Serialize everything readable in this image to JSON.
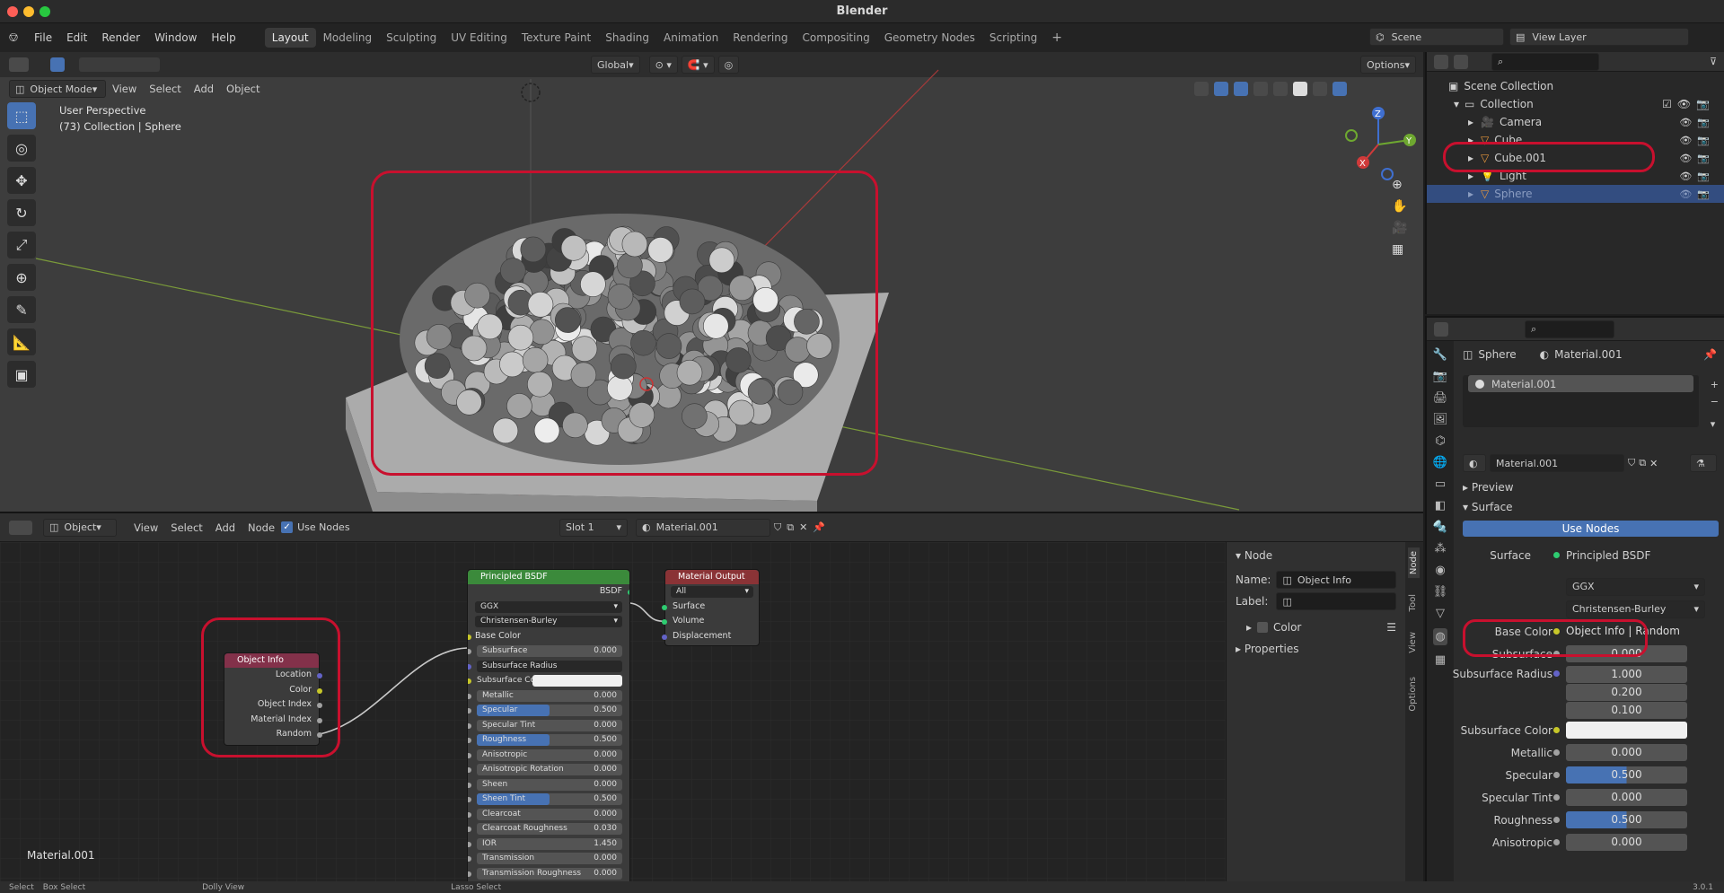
{
  "app": {
    "title": "Blender"
  },
  "menu": {
    "items": [
      "File",
      "Edit",
      "Render",
      "Window",
      "Help"
    ]
  },
  "workspaces": [
    "Layout",
    "Modeling",
    "Sculpting",
    "UV Editing",
    "Texture Paint",
    "Shading",
    "Animation",
    "Rendering",
    "Compositing",
    "Geometry Nodes",
    "Scripting"
  ],
  "active_workspace": "Layout",
  "scene": {
    "label": "Scene",
    "view_layer": "View Layer"
  },
  "viewport": {
    "mode": "Object Mode",
    "menus": [
      "View",
      "Select",
      "Add",
      "Object"
    ],
    "transform": "Global",
    "options": "Options",
    "info_line1": "User Perspective",
    "info_line2": "(73) Collection | Sphere"
  },
  "outliner": {
    "root": "Scene Collection",
    "collection": "Collection",
    "items": [
      {
        "name": "Camera"
      },
      {
        "name": "Cube"
      },
      {
        "name": "Cube.001"
      },
      {
        "name": "Light"
      },
      {
        "name": "Sphere"
      }
    ]
  },
  "properties": {
    "object_name": "Sphere",
    "material_name": "Material.001",
    "slot_material": "Material.001",
    "datablock": "Material.001",
    "preview": "Preview",
    "surface_section": "Surface",
    "use_nodes": "Use Nodes",
    "surface_label": "Surface",
    "surface_value": "Principled BSDF",
    "distribution": "GGX",
    "subsurface_method": "Christensen-Burley",
    "rows": [
      {
        "label": "Base Color",
        "value": "Object Info | Random"
      },
      {
        "label": "Subsurface",
        "value": "0.000"
      },
      {
        "label": "Subsurface Radius",
        "value": "1.000"
      },
      {
        "label": "",
        "value": "0.200"
      },
      {
        "label": "",
        "value": "0.100"
      },
      {
        "label": "Subsurface Color",
        "value": ""
      },
      {
        "label": "Metallic",
        "value": "0.000"
      },
      {
        "label": "Specular",
        "value": "0.500"
      },
      {
        "label": "Specular Tint",
        "value": "0.000"
      },
      {
        "label": "Roughness",
        "value": "0.500"
      },
      {
        "label": "Anisotropic",
        "value": "0.000"
      }
    ]
  },
  "node_editor": {
    "type": "Object",
    "menus": [
      "View",
      "Select",
      "Add",
      "Node"
    ],
    "use_nodes": "Use Nodes",
    "slot": "Slot 1",
    "material": "Material.001",
    "footer_label": "Material.001",
    "sidebar": {
      "section": "Node",
      "name_label": "Name:",
      "name_value": "Object Info",
      "label_label": "Label:",
      "color": "Color",
      "properties": "Properties",
      "tabs": [
        "Node",
        "Tool",
        "View",
        "Options"
      ]
    },
    "object_info": {
      "title": "Object Info",
      "outputs": [
        "Location",
        "Color",
        "Object Index",
        "Material Index",
        "Random"
      ]
    },
    "principled": {
      "title": "Principled BSDF",
      "output": "BSDF",
      "distribution": "GGX",
      "ss_method": "Christensen-Burley",
      "base_color": "Base Color",
      "inputs": [
        {
          "label": "Subsurface",
          "value": "0.000",
          "fill": 0
        },
        {
          "label": "Subsurface Radius",
          "value": "",
          "fill": 0
        },
        {
          "label": "Subsurface Co...",
          "value": "",
          "fill": 0
        },
        {
          "label": "Metallic",
          "value": "0.000",
          "fill": 0
        },
        {
          "label": "Specular",
          "value": "0.500",
          "fill": 0.5
        },
        {
          "label": "Specular Tint",
          "value": "0.000",
          "fill": 0
        },
        {
          "label": "Roughness",
          "value": "0.500",
          "fill": 0.5
        },
        {
          "label": "Anisotropic",
          "value": "0.000",
          "fill": 0
        },
        {
          "label": "Anisotropic Rotation",
          "value": "0.000",
          "fill": 0
        },
        {
          "label": "Sheen",
          "value": "0.000",
          "fill": 0
        },
        {
          "label": "Sheen Tint",
          "value": "0.500",
          "fill": 0.5
        },
        {
          "label": "Clearcoat",
          "value": "0.000",
          "fill": 0
        },
        {
          "label": "Clearcoat Roughness",
          "value": "0.030",
          "fill": 0.03
        },
        {
          "label": "IOR",
          "value": "1.450",
          "fill": 0
        },
        {
          "label": "Transmission",
          "value": "0.000",
          "fill": 0
        },
        {
          "label": "Transmission Roughness",
          "value": "0.000",
          "fill": 0
        }
      ]
    },
    "output": {
      "title": "Material Output",
      "target": "All",
      "inputs": [
        "Surface",
        "Volume",
        "Displacement"
      ]
    }
  },
  "statusbar": {
    "items": [
      "Select",
      "Box Select",
      "Dolly View",
      "Lasso Select"
    ],
    "version": "3.0.1"
  }
}
